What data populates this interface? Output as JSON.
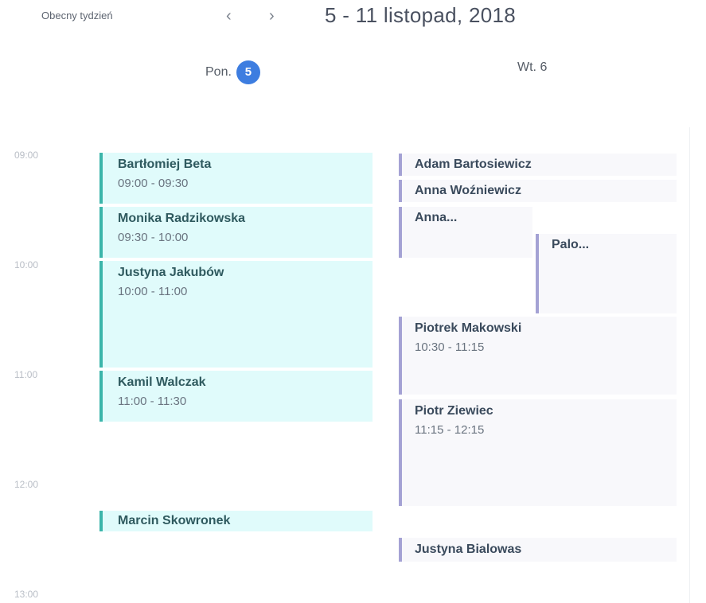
{
  "header": {
    "current_week_label": "Obecny tydzień",
    "prev_icon": "‹",
    "next_icon": "›",
    "date_range": "5 - 11 listopad,  2018"
  },
  "days": [
    {
      "name": "Pon.",
      "number": "5"
    },
    {
      "name": "Wt. 6"
    }
  ],
  "time_labels": [
    "09:00",
    "10:00",
    "11:00",
    "12:00",
    "13:00"
  ],
  "events": {
    "monday": [
      {
        "name": "Bartłomiej Beta",
        "time": "09:00 - 09:30"
      },
      {
        "name": "Monika Radzikowska",
        "time": "09:30 - 10:00"
      },
      {
        "name": "Justyna Jakubów",
        "time": "10:00 - 11:00"
      },
      {
        "name": "Kamil Walczak",
        "time": "11:00 - 11:30"
      },
      {
        "name": "Marcin Skowronek"
      }
    ],
    "tuesday": [
      {
        "name": "Adam Bartosiewicz"
      },
      {
        "name": "Anna Woźniewicz"
      },
      {
        "name": "Anna..."
      },
      {
        "name": "Palo..."
      },
      {
        "name": "Piotrek Makowski",
        "time": "10:30 - 11:15"
      },
      {
        "name": "Piotr Ziewiec",
        "time": "11:15 - 12:15"
      },
      {
        "name": "Justyna Bialowas"
      }
    ]
  },
  "colors": {
    "accent": "#3d7de0",
    "monday_event_bg": "#e0fbfb",
    "monday_event_border": "#3bb5aa",
    "tuesday_event_bg": "#f8f8fb",
    "tuesday_event_border": "#a4a2d4"
  }
}
